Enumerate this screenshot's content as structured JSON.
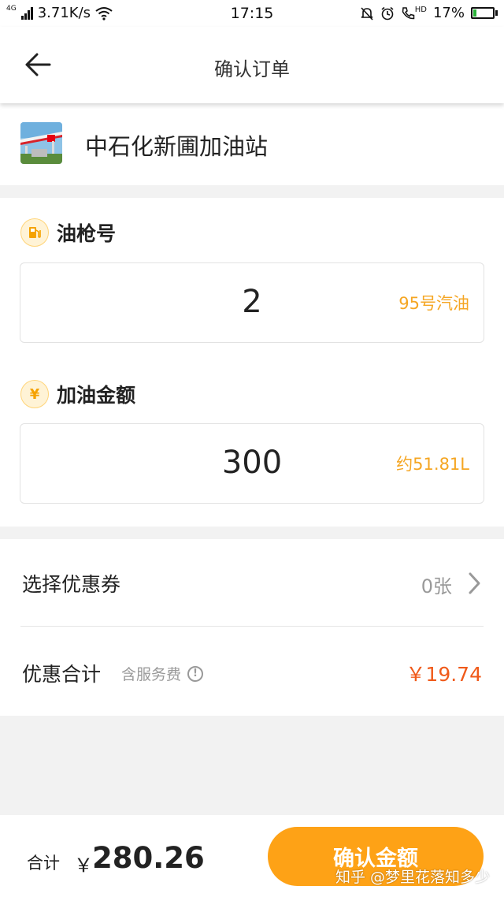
{
  "status_bar": {
    "network_tag": "4G",
    "speed": "3.71K/s",
    "time": "17:15",
    "hd_label": "HD",
    "battery": "17%",
    "battery_level": 0.17
  },
  "nav": {
    "title": "确认订单"
  },
  "station": {
    "name": "中石化新圃加油站"
  },
  "pump": {
    "title": "油枪号",
    "value": "2",
    "fuel_type": "95号汽油"
  },
  "amount": {
    "title": "加油金额",
    "icon_glyph": "¥",
    "value": "300",
    "liters": "约51.81L"
  },
  "coupon": {
    "label": "选择优惠券",
    "count": "0张"
  },
  "discount": {
    "label": "优惠合计",
    "note": "含服务费",
    "info_glyph": "!",
    "value": "￥19.74"
  },
  "footer": {
    "total_label": "合计",
    "currency": "￥",
    "total_value": "280.26",
    "confirm_label": "确认金额",
    "watermark": "知乎 @梦里花落知多少"
  },
  "colors": {
    "accent": "#fea216",
    "hint": "#f5a623",
    "discount": "#f05a1a"
  }
}
